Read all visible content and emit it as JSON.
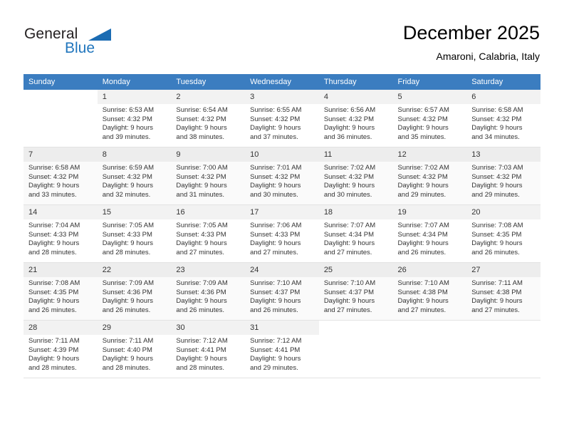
{
  "brand": {
    "name_part1": "General",
    "name_part2": "Blue",
    "logo_icon": "triangle-logo-icon",
    "accent_color": "#2176bd"
  },
  "header": {
    "title": "December 2025",
    "subtitle": "Amaroni, Calabria, Italy"
  },
  "calendar": {
    "header_bg_color": "#3b7dc0",
    "weekdays": [
      "Sunday",
      "Monday",
      "Tuesday",
      "Wednesday",
      "Thursday",
      "Friday",
      "Saturday"
    ],
    "weeks": [
      [
        {
          "day": "",
          "sunrise": "",
          "sunset": "",
          "daylight_line1": "",
          "daylight_line2": ""
        },
        {
          "day": "1",
          "sunrise": "Sunrise: 6:53 AM",
          "sunset": "Sunset: 4:32 PM",
          "daylight_line1": "Daylight: 9 hours",
          "daylight_line2": "and 39 minutes."
        },
        {
          "day": "2",
          "sunrise": "Sunrise: 6:54 AM",
          "sunset": "Sunset: 4:32 PM",
          "daylight_line1": "Daylight: 9 hours",
          "daylight_line2": "and 38 minutes."
        },
        {
          "day": "3",
          "sunrise": "Sunrise: 6:55 AM",
          "sunset": "Sunset: 4:32 PM",
          "daylight_line1": "Daylight: 9 hours",
          "daylight_line2": "and 37 minutes."
        },
        {
          "day": "4",
          "sunrise": "Sunrise: 6:56 AM",
          "sunset": "Sunset: 4:32 PM",
          "daylight_line1": "Daylight: 9 hours",
          "daylight_line2": "and 36 minutes."
        },
        {
          "day": "5",
          "sunrise": "Sunrise: 6:57 AM",
          "sunset": "Sunset: 4:32 PM",
          "daylight_line1": "Daylight: 9 hours",
          "daylight_line2": "and 35 minutes."
        },
        {
          "day": "6",
          "sunrise": "Sunrise: 6:58 AM",
          "sunset": "Sunset: 4:32 PM",
          "daylight_line1": "Daylight: 9 hours",
          "daylight_line2": "and 34 minutes."
        }
      ],
      [
        {
          "day": "7",
          "sunrise": "Sunrise: 6:58 AM",
          "sunset": "Sunset: 4:32 PM",
          "daylight_line1": "Daylight: 9 hours",
          "daylight_line2": "and 33 minutes."
        },
        {
          "day": "8",
          "sunrise": "Sunrise: 6:59 AM",
          "sunset": "Sunset: 4:32 PM",
          "daylight_line1": "Daylight: 9 hours",
          "daylight_line2": "and 32 minutes."
        },
        {
          "day": "9",
          "sunrise": "Sunrise: 7:00 AM",
          "sunset": "Sunset: 4:32 PM",
          "daylight_line1": "Daylight: 9 hours",
          "daylight_line2": "and 31 minutes."
        },
        {
          "day": "10",
          "sunrise": "Sunrise: 7:01 AM",
          "sunset": "Sunset: 4:32 PM",
          "daylight_line1": "Daylight: 9 hours",
          "daylight_line2": "and 30 minutes."
        },
        {
          "day": "11",
          "sunrise": "Sunrise: 7:02 AM",
          "sunset": "Sunset: 4:32 PM",
          "daylight_line1": "Daylight: 9 hours",
          "daylight_line2": "and 30 minutes."
        },
        {
          "day": "12",
          "sunrise": "Sunrise: 7:02 AM",
          "sunset": "Sunset: 4:32 PM",
          "daylight_line1": "Daylight: 9 hours",
          "daylight_line2": "and 29 minutes."
        },
        {
          "day": "13",
          "sunrise": "Sunrise: 7:03 AM",
          "sunset": "Sunset: 4:32 PM",
          "daylight_line1": "Daylight: 9 hours",
          "daylight_line2": "and 29 minutes."
        }
      ],
      [
        {
          "day": "14",
          "sunrise": "Sunrise: 7:04 AM",
          "sunset": "Sunset: 4:33 PM",
          "daylight_line1": "Daylight: 9 hours",
          "daylight_line2": "and 28 minutes."
        },
        {
          "day": "15",
          "sunrise": "Sunrise: 7:05 AM",
          "sunset": "Sunset: 4:33 PM",
          "daylight_line1": "Daylight: 9 hours",
          "daylight_line2": "and 28 minutes."
        },
        {
          "day": "16",
          "sunrise": "Sunrise: 7:05 AM",
          "sunset": "Sunset: 4:33 PM",
          "daylight_line1": "Daylight: 9 hours",
          "daylight_line2": "and 27 minutes."
        },
        {
          "day": "17",
          "sunrise": "Sunrise: 7:06 AM",
          "sunset": "Sunset: 4:33 PM",
          "daylight_line1": "Daylight: 9 hours",
          "daylight_line2": "and 27 minutes."
        },
        {
          "day": "18",
          "sunrise": "Sunrise: 7:07 AM",
          "sunset": "Sunset: 4:34 PM",
          "daylight_line1": "Daylight: 9 hours",
          "daylight_line2": "and 27 minutes."
        },
        {
          "day": "19",
          "sunrise": "Sunrise: 7:07 AM",
          "sunset": "Sunset: 4:34 PM",
          "daylight_line1": "Daylight: 9 hours",
          "daylight_line2": "and 26 minutes."
        },
        {
          "day": "20",
          "sunrise": "Sunrise: 7:08 AM",
          "sunset": "Sunset: 4:35 PM",
          "daylight_line1": "Daylight: 9 hours",
          "daylight_line2": "and 26 minutes."
        }
      ],
      [
        {
          "day": "21",
          "sunrise": "Sunrise: 7:08 AM",
          "sunset": "Sunset: 4:35 PM",
          "daylight_line1": "Daylight: 9 hours",
          "daylight_line2": "and 26 minutes."
        },
        {
          "day": "22",
          "sunrise": "Sunrise: 7:09 AM",
          "sunset": "Sunset: 4:36 PM",
          "daylight_line1": "Daylight: 9 hours",
          "daylight_line2": "and 26 minutes."
        },
        {
          "day": "23",
          "sunrise": "Sunrise: 7:09 AM",
          "sunset": "Sunset: 4:36 PM",
          "daylight_line1": "Daylight: 9 hours",
          "daylight_line2": "and 26 minutes."
        },
        {
          "day": "24",
          "sunrise": "Sunrise: 7:10 AM",
          "sunset": "Sunset: 4:37 PM",
          "daylight_line1": "Daylight: 9 hours",
          "daylight_line2": "and 26 minutes."
        },
        {
          "day": "25",
          "sunrise": "Sunrise: 7:10 AM",
          "sunset": "Sunset: 4:37 PM",
          "daylight_line1": "Daylight: 9 hours",
          "daylight_line2": "and 27 minutes."
        },
        {
          "day": "26",
          "sunrise": "Sunrise: 7:10 AM",
          "sunset": "Sunset: 4:38 PM",
          "daylight_line1": "Daylight: 9 hours",
          "daylight_line2": "and 27 minutes."
        },
        {
          "day": "27",
          "sunrise": "Sunrise: 7:11 AM",
          "sunset": "Sunset: 4:38 PM",
          "daylight_line1": "Daylight: 9 hours",
          "daylight_line2": "and 27 minutes."
        }
      ],
      [
        {
          "day": "28",
          "sunrise": "Sunrise: 7:11 AM",
          "sunset": "Sunset: 4:39 PM",
          "daylight_line1": "Daylight: 9 hours",
          "daylight_line2": "and 28 minutes."
        },
        {
          "day": "29",
          "sunrise": "Sunrise: 7:11 AM",
          "sunset": "Sunset: 4:40 PM",
          "daylight_line1": "Daylight: 9 hours",
          "daylight_line2": "and 28 minutes."
        },
        {
          "day": "30",
          "sunrise": "Sunrise: 7:12 AM",
          "sunset": "Sunset: 4:41 PM",
          "daylight_line1": "Daylight: 9 hours",
          "daylight_line2": "and 28 minutes."
        },
        {
          "day": "31",
          "sunrise": "Sunrise: 7:12 AM",
          "sunset": "Sunset: 4:41 PM",
          "daylight_line1": "Daylight: 9 hours",
          "daylight_line2": "and 29 minutes."
        },
        {
          "day": "",
          "sunrise": "",
          "sunset": "",
          "daylight_line1": "",
          "daylight_line2": ""
        },
        {
          "day": "",
          "sunrise": "",
          "sunset": "",
          "daylight_line1": "",
          "daylight_line2": ""
        },
        {
          "day": "",
          "sunrise": "",
          "sunset": "",
          "daylight_line1": "",
          "daylight_line2": ""
        }
      ]
    ]
  }
}
